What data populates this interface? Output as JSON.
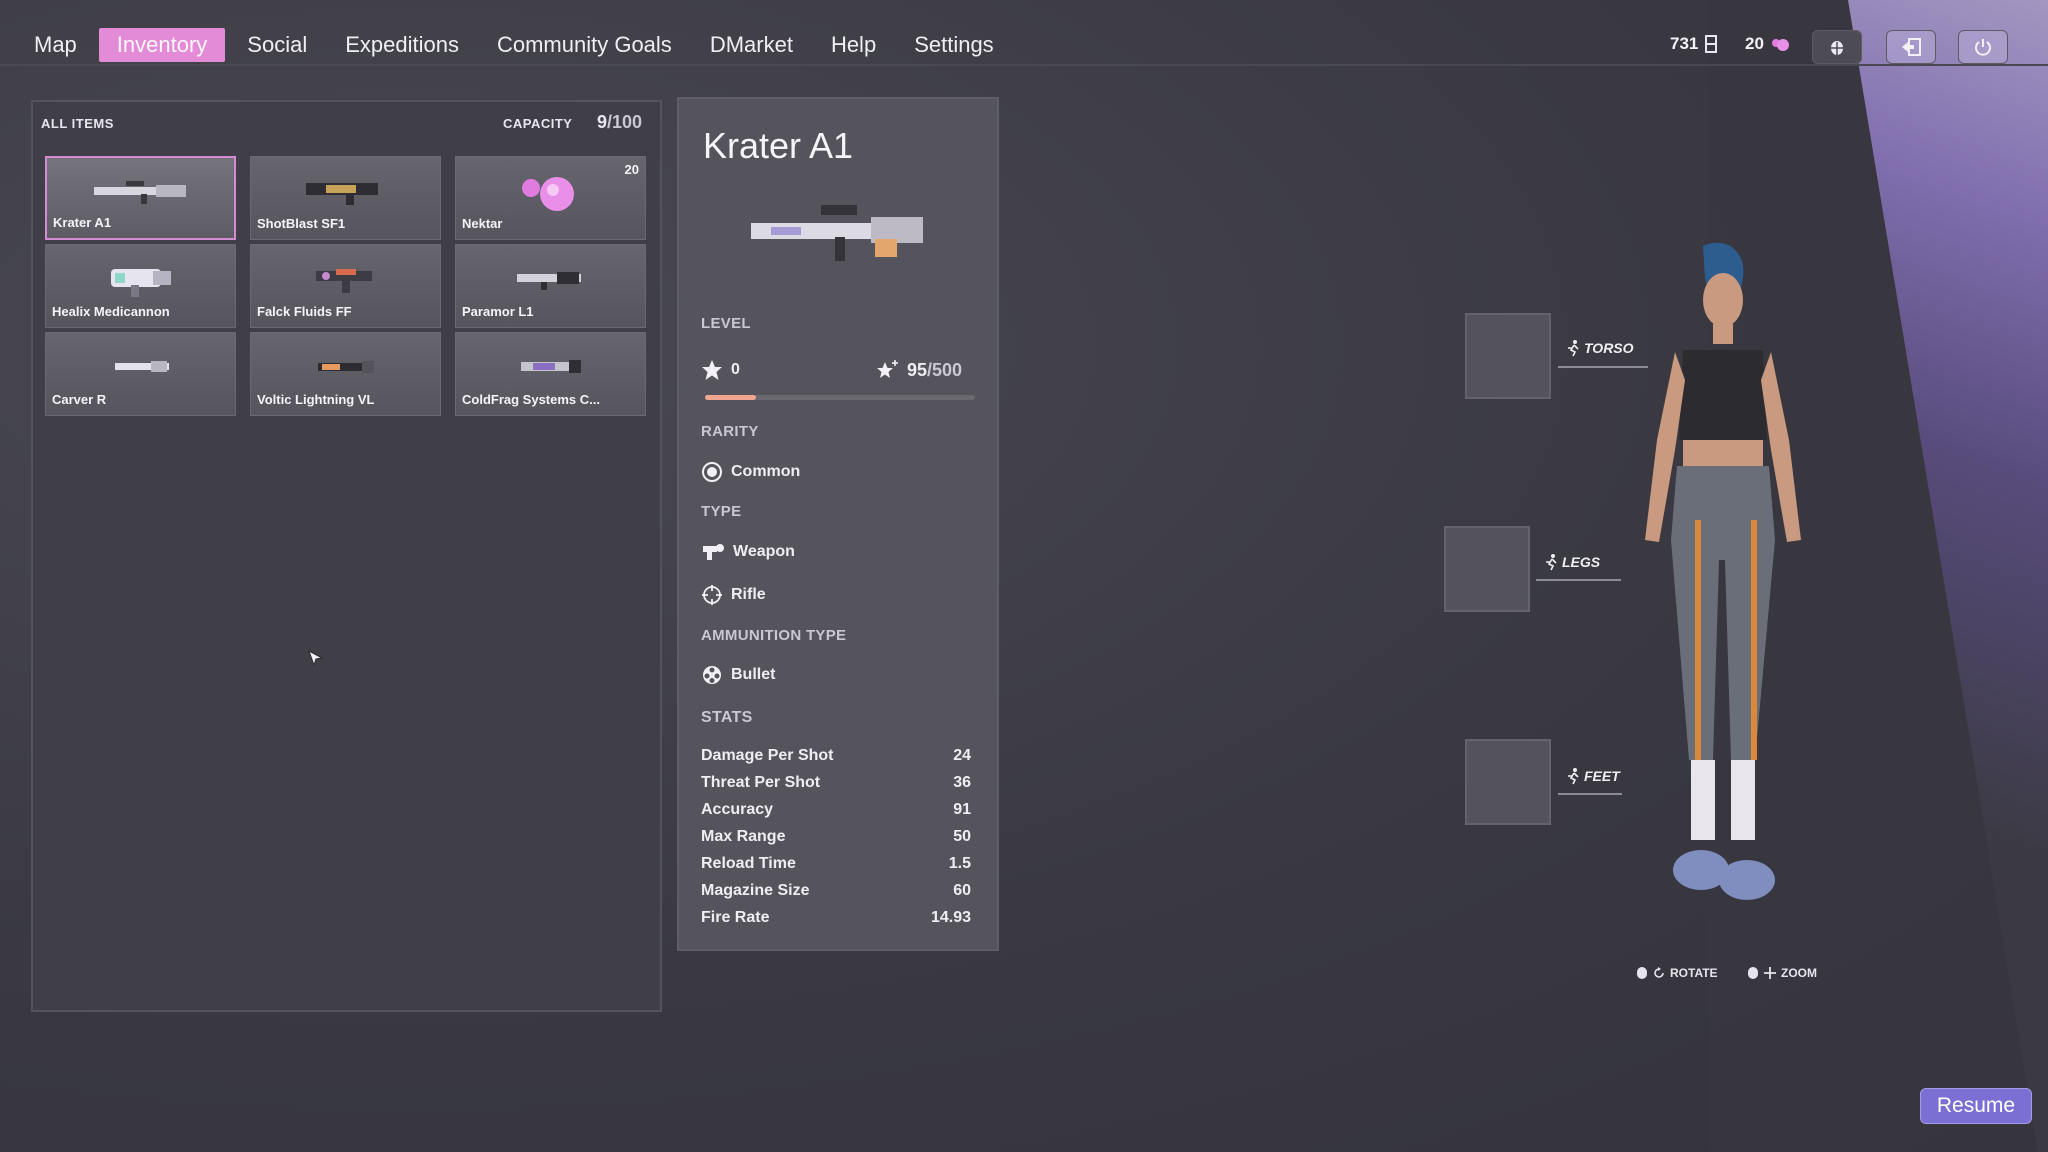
{
  "nav": {
    "tabs": [
      "Map",
      "Inventory",
      "Social",
      "Expeditions",
      "Community Goals",
      "DMarket",
      "Help",
      "Settings"
    ],
    "active_tab": "Inventory",
    "currency_a": "731",
    "currency_b": "20"
  },
  "inventory": {
    "header": "ALL ITEMS",
    "capacity_label": "CAPACITY",
    "capacity_used": "9",
    "capacity_max": "/100",
    "items": [
      {
        "name": "Krater A1",
        "count": ""
      },
      {
        "name": "ShotBlast SF1",
        "count": ""
      },
      {
        "name": "Nektar",
        "count": "20"
      },
      {
        "name": "Healix Medicannon",
        "count": ""
      },
      {
        "name": "Falck Fluids FF",
        "count": ""
      },
      {
        "name": "Paramor L1",
        "count": ""
      },
      {
        "name": "Carver R",
        "count": ""
      },
      {
        "name": "Voltic Lightning VL",
        "count": ""
      },
      {
        "name": "ColdFrag Systems C..."
      }
    ]
  },
  "detail": {
    "title": "Krater A1",
    "level_label": "LEVEL",
    "level_value": "0",
    "xp_current": "95",
    "xp_max": "/500",
    "xp_progress": 0.19,
    "rarity_label": "RARITY",
    "rarity_value": "Common",
    "type_label": "TYPE",
    "type_value": "Weapon",
    "subtype_value": "Rifle",
    "ammo_label": "AMMUNITION TYPE",
    "ammo_value": "Bullet",
    "stats_label": "STATS",
    "stats": [
      {
        "label": "Damage Per Shot",
        "value": "24"
      },
      {
        "label": "Threat Per Shot",
        "value": "36"
      },
      {
        "label": "Accuracy",
        "value": "91"
      },
      {
        "label": "Max Range",
        "value": "50"
      },
      {
        "label": "Reload Time",
        "value": "1.5"
      },
      {
        "label": "Magazine Size",
        "value": "60"
      },
      {
        "label": "Fire Rate",
        "value": "14.93"
      }
    ]
  },
  "equipment": {
    "torso": "TORSO",
    "legs": "LEGS",
    "feet": "FEET"
  },
  "hints": {
    "rotate": "ROTATE",
    "zoom": "ZOOM"
  },
  "resume_label": "Resume"
}
